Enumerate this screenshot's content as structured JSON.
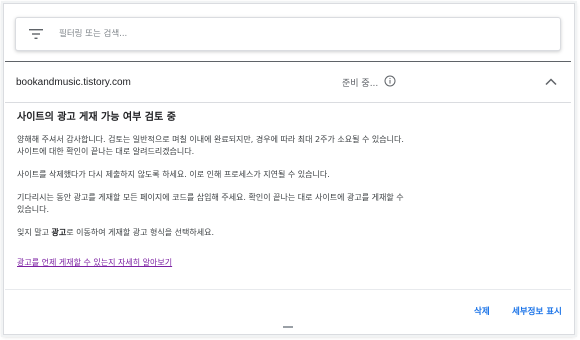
{
  "filter": {
    "placeholder": "필터링 또는 검색..."
  },
  "site": {
    "name": "bookandmusic.tistory.com",
    "status": "준비 중..."
  },
  "review": {
    "title": "사이트의 광고 게재 가능 여부 검토 중",
    "para1_line1": "양해해 주셔서 감사합니다. 검토는 일반적으로 며칠 이내에 완료되지만, 경우에 따라 최대 2주가 소요될 수 있습니다.",
    "para1_line2": "사이트에 대한 확인이 끝나는 대로 알려드리겠습니다.",
    "para2": "사이트를 삭제했다가 다시 제출하지 않도록 하세요. 이로 인해 프로세스가 지연될 수 있습니다.",
    "para3_line1": "기다리시는 동안 광고를 게재할 모든 페이지에 코드를 삽입해 주세요. 확인이 끝나는 대로 사이트에 광고를 게재할 수",
    "para3_line2": "있습니다.",
    "para4_before": "잊지 말고 ",
    "para4_bold": "광고",
    "para4_after": "로 이동하여 게재할 광고 형식을 선택하세요.",
    "learn_more": "광고를 언제 게재할 수 있는지 자세히 알아보기"
  },
  "actions": {
    "delete": "삭제",
    "details": "세부정보 표시"
  }
}
